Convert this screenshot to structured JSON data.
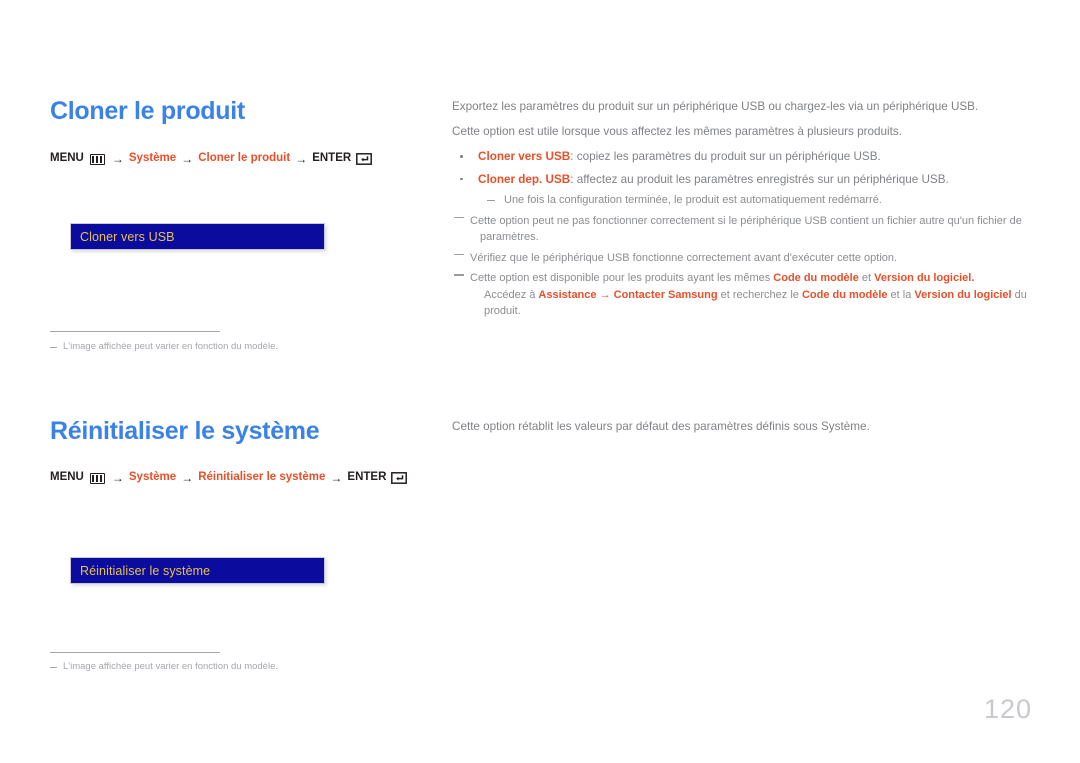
{
  "page": {
    "number": "120",
    "language": "fr"
  },
  "sections": [
    {
      "id": "cloner-le-produit",
      "heading": "Cloner le produit",
      "breadcrumb": {
        "menu_label": "MENU",
        "menu_icon": "menu-grid-icon",
        "arrow": "→",
        "path_1": "Système",
        "path_2": "Cloner le produit",
        "enter_label": "ENTER",
        "enter_icon": "enter-key-icon"
      },
      "screenbox": {
        "label": "Cloner vers USB"
      },
      "footnote": {
        "dash": "dash-marker",
        "text": "L'image affichée peut varier en fonction du modèle."
      },
      "body": {
        "paragraphs": [
          "Exportez les paramètres du produit sur un périphérique USB ou chargez-les via un périphérique USB.",
          "Cette option est utile lorsque vous affectez les mêmes paramètres à plusieurs produits."
        ],
        "bullets": [
          {
            "term": "Cloner vers USB",
            "rest": ": copiez les paramètres du produit sur un périphérique USB.",
            "subs": []
          },
          {
            "term": "Cloner dep. USB",
            "rest": ": affectez au produit les paramètres enregistrés sur un périphérique USB.",
            "subs": [
              "Une fois la configuration terminée, le produit est automatiquement redémarré."
            ]
          }
        ],
        "notes": [
          {
            "line1": "Cette option peut ne pas fonctionner correctement si le périphérique USB contient un fichier autre qu'un fichier de",
            "line2": "paramètres."
          },
          {
            "line1": "Vérifiez que le périphérique USB fonctionne correctement avant d'exécuter cette option.",
            "line2": ""
          }
        ],
        "note_rich": {
          "lead": "Cette option est disponible pour les produits ayant les mêmes ",
          "term_1": "Code du modèle",
          "mid_1": " et ",
          "term_2": "Version du logiciel",
          "tail_1": ".",
          "line2_lead": "Accédez à ",
          "term_3": "Assistance",
          "arrow": " → ",
          "term_4": "Contacter Samsung",
          "mid_2": " et recherchez le ",
          "term_5": "Code du modèle",
          "mid_3": " et la ",
          "term_6": "Version du logiciel",
          "tail_2": " du produit."
        }
      }
    },
    {
      "id": "reinitialiser-le-systeme",
      "heading": "Réinitialiser le système",
      "breadcrumb": {
        "menu_label": "MENU",
        "menu_icon": "menu-grid-icon",
        "arrow": "→",
        "path_1": "Système",
        "path_2": "Réinitialiser le système",
        "enter_label": "ENTER",
        "enter_icon": "enter-key-icon"
      },
      "screenbox": {
        "label": "Réinitialiser le système"
      },
      "footnote": {
        "dash": "dash-marker",
        "text": "L'image affichée peut varier en fonction du modèle."
      },
      "body": {
        "paragraphs": [
          "Cette option rétablit les valeurs par défaut des paramètres définis sous Système."
        ]
      }
    }
  ],
  "colors": {
    "heading_blue": "#3b82e8",
    "accent_red": "#e8502a",
    "screenbox_bg": "#0b0b9e",
    "screenbox_text": "#e8c44a",
    "body_gray": "#808285",
    "footnote_gray": "#a5a7ad",
    "page_number_gray": "#c7c9cc"
  }
}
